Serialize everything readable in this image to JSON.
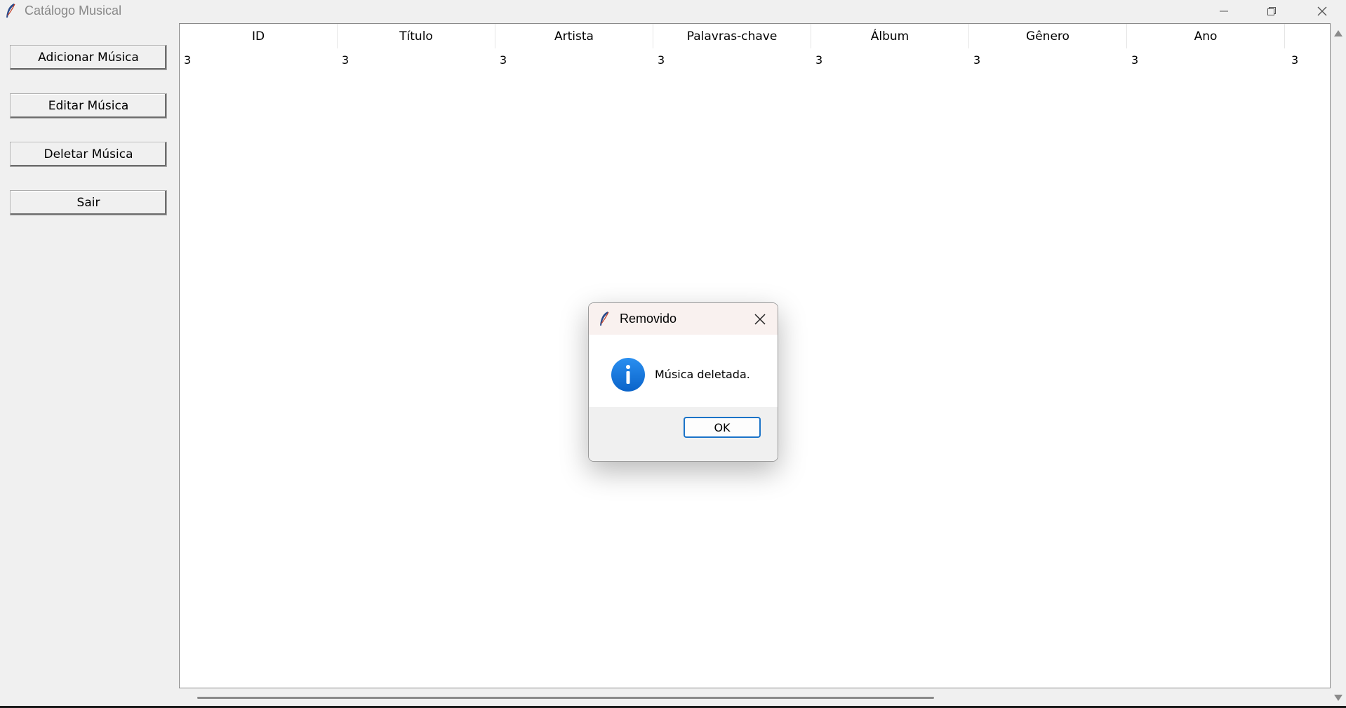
{
  "window": {
    "title": "Catálogo Musical",
    "icon": "feather-icon"
  },
  "sidebar": {
    "buttons": [
      {
        "label": "Adicionar Música"
      },
      {
        "label": "Editar Música"
      },
      {
        "label": "Deletar Música"
      },
      {
        "label": "Sair"
      }
    ]
  },
  "table": {
    "columns": [
      "ID",
      "Título",
      "Artista",
      "Palavras-chave",
      "Álbum",
      "Gênero",
      "Ano"
    ],
    "rows": [
      [
        "3",
        "3",
        "3",
        "3",
        "3",
        "3",
        "3",
        "3"
      ]
    ]
  },
  "dialog": {
    "title": "Removido",
    "message": "Música deletada.",
    "ok_label": "OK",
    "icon": "info-icon",
    "accent_color": "#1a73c8"
  }
}
